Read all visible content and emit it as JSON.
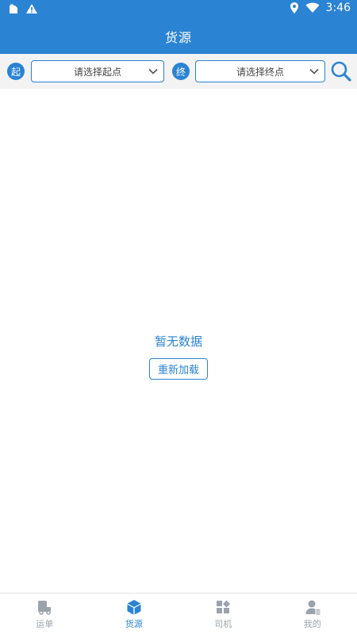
{
  "status_bar": {
    "time": "3:46",
    "left_icons": [
      "sim-card-icon",
      "warning-icon"
    ],
    "right_icons": [
      "location-pin-icon",
      "wifi-icon"
    ]
  },
  "header": {
    "title": "货源"
  },
  "filters": {
    "origin_badge": "起",
    "origin_placeholder": "请选择起点",
    "destination_badge": "终",
    "destination_placeholder": "请选择终点",
    "search_icon": "search-icon"
  },
  "main": {
    "empty_message": "暂无数据",
    "reload_label": "重新加载"
  },
  "tabbar": {
    "items": [
      {
        "label": "运单",
        "icon": "waybill-icon",
        "active": false
      },
      {
        "label": "货源",
        "icon": "cargo-box-icon",
        "active": true
      },
      {
        "label": "司机",
        "icon": "driver-grid-icon",
        "active": false
      },
      {
        "label": "我的",
        "icon": "profile-icon",
        "active": false
      }
    ]
  },
  "colors": {
    "primary": "#2b83d3",
    "inactive": "#9aa3ad",
    "filter_bg": "#f3f3f3"
  }
}
